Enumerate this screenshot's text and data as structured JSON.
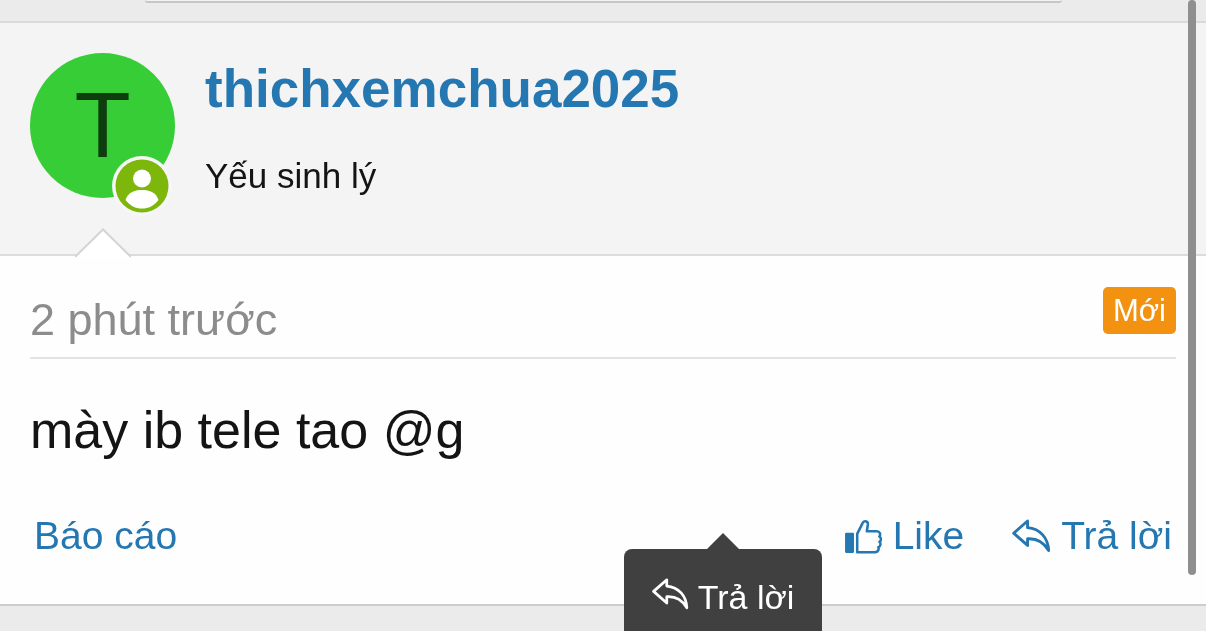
{
  "post": {
    "author": {
      "avatar_letter": "T",
      "name": "thichxemchua2025",
      "title": "Yếu sinh lý"
    },
    "time": "2 phút trước",
    "badge": "Mới",
    "message": "mày ib tele tao @g",
    "actions": [
      {
        "kind": "report",
        "label": "Báo cáo"
      },
      {
        "kind": "like",
        "label": "Like"
      },
      {
        "kind": "reply",
        "label": "Trả lời"
      }
    ]
  },
  "tooltip": {
    "label": "Trả lời"
  }
}
